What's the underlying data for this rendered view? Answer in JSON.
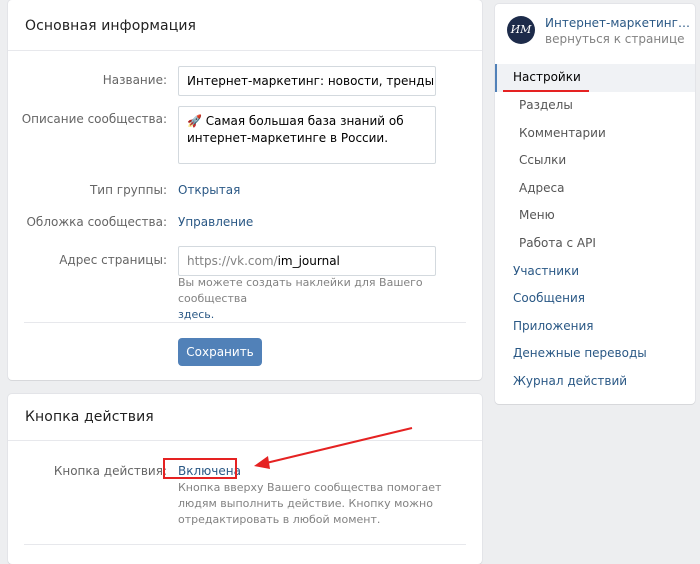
{
  "main": {
    "title": "Основная информация",
    "name_label": "Название:",
    "name_value": "Интернет-маркетинг: новости, тренды, стат",
    "desc_label": "Описание сообщества:",
    "desc_value": "🚀 Самая большая база знаний об интернет-маркетинге в России.",
    "type_label": "Тип группы:",
    "type_value": "Открытая",
    "cover_label": "Обложка сообщества:",
    "cover_value": "Управление",
    "address_label": "Адрес страницы:",
    "address_prefix": "https://vk.com/",
    "address_value": "im_journal",
    "hint_text": "Вы можете создать наклейки для Вашего сообщества",
    "hint_link": "здесь.",
    "save_label": "Сохранить"
  },
  "action": {
    "title": "Кнопка действия",
    "label": "Кнопка действия:",
    "value": "Включена",
    "hint": "Кнопка вверху Вашего сообщества помогает людям выполнить действие. Кнопку можно отредактировать в любой момент."
  },
  "sidebar": {
    "avatar_text": "ИМ",
    "group_name": "Интернет-маркетинг: н...",
    "back_text": "вернуться к странице",
    "active": "Настройки",
    "subitems": [
      "Разделы",
      "Комментарии",
      "Ссылки",
      "Адреса",
      "Меню",
      "Работа с API"
    ],
    "items": [
      "Участники",
      "Сообщения",
      "Приложения",
      "Денежные переводы",
      "Журнал действий"
    ]
  }
}
